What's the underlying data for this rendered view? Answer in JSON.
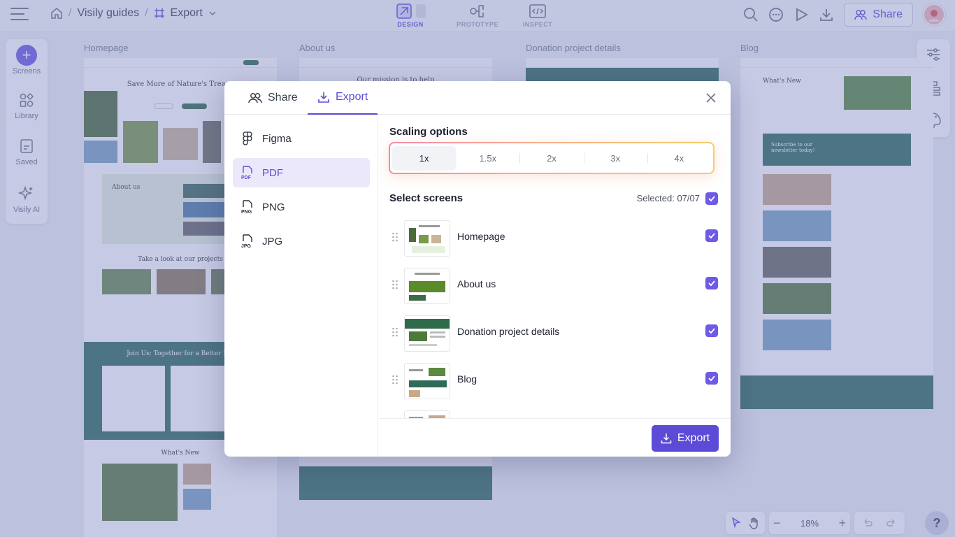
{
  "topbar": {
    "breadcrumb": {
      "project": "Visily guides",
      "page": "Export"
    },
    "modes": [
      {
        "label": "DESIGN",
        "icon": "design-icon",
        "active": true
      },
      {
        "label": "PROTOTYPE",
        "icon": "prototype-icon",
        "active": false
      },
      {
        "label": "INSPECT",
        "icon": "inspect-icon",
        "active": false
      }
    ],
    "share_label": "Share"
  },
  "left_rail": {
    "items": [
      {
        "label": "Screens",
        "icon": "plus-icon"
      },
      {
        "label": "Library",
        "icon": "library-icon"
      },
      {
        "label": "Saved",
        "icon": "saved-icon"
      },
      {
        "label": "Visily AI",
        "icon": "sparkle-icon"
      }
    ]
  },
  "canvas": {
    "frames": [
      {
        "title": "Homepage"
      },
      {
        "title": "About us"
      },
      {
        "title": "Donation project details"
      },
      {
        "title": "Blog"
      }
    ],
    "homepage": {
      "hero": "Save More of Nature's Treasu",
      "about": "About us",
      "projects": "Take a look at our projects",
      "join": "Join Us: Together for a Better Fut",
      "whatsnew": "What's New"
    },
    "about": {
      "mission": "Our mission is to help"
    },
    "blog": {
      "heading": "What's New",
      "subscribe": "Subscribe to our newsletter today!"
    }
  },
  "bottombar": {
    "zoom": "18%"
  },
  "modal": {
    "tabs": [
      {
        "label": "Share",
        "icon": "share-icon",
        "active": false
      },
      {
        "label": "Export",
        "icon": "download-icon",
        "active": true
      }
    ],
    "formats": [
      {
        "label": "Figma",
        "icon": "figma-icon",
        "active": false
      },
      {
        "label": "PDF",
        "icon": "pdf-file-icon",
        "active": true
      },
      {
        "label": "PNG",
        "icon": "png-file-icon",
        "active": false
      },
      {
        "label": "JPG",
        "icon": "jpg-file-icon",
        "active": false
      }
    ],
    "scaling": {
      "title": "Scaling options",
      "options": [
        "1x",
        "1.5x",
        "2x",
        "3x",
        "4x"
      ],
      "selected": "1x"
    },
    "screens": {
      "title": "Select screens",
      "selected_label": "Selected: 07/07",
      "items": [
        {
          "name": "Homepage",
          "checked": true
        },
        {
          "name": "About us",
          "checked": true
        },
        {
          "name": "Donation project details",
          "checked": true
        },
        {
          "name": "Blog",
          "checked": true
        }
      ]
    },
    "export_label": "Export",
    "colors": {
      "accent": "#5b4bd6",
      "active_bg": "#ebe8fc"
    }
  }
}
